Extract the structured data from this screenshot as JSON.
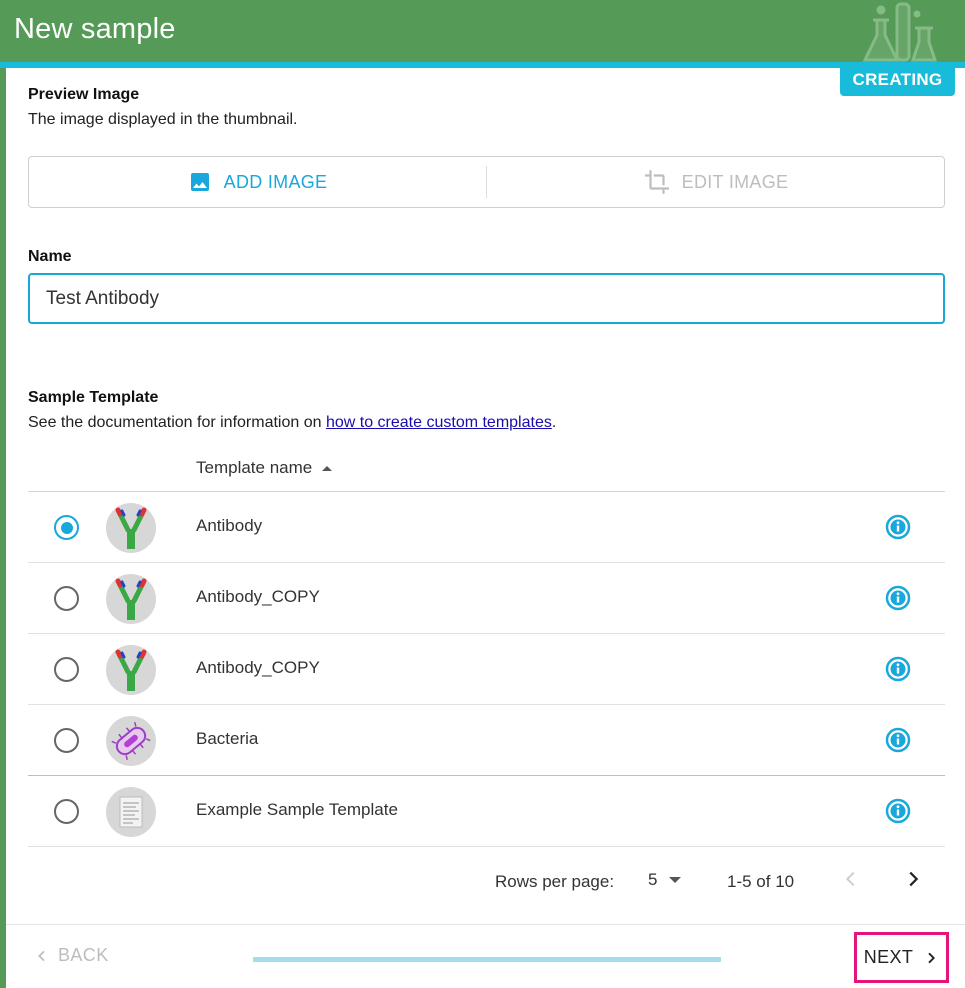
{
  "header": {
    "title": "New sample",
    "status_badge": "CREATING"
  },
  "preview_image": {
    "title": "Preview Image",
    "description": "The image displayed in the thumbnail.",
    "add_label": "ADD IMAGE",
    "edit_label": "EDIT IMAGE"
  },
  "name_field": {
    "label": "Name",
    "value": "Test Antibody"
  },
  "template": {
    "title": "Sample Template",
    "description_prefix": "See the documentation for information on ",
    "link_text": "how to create custom templates",
    "description_suffix": ".",
    "column_header": "Template name",
    "sort": "ascending",
    "rows": [
      {
        "name": "Antibody",
        "selected": true,
        "icon": "antibody-icon"
      },
      {
        "name": "Antibody_COPY",
        "selected": false,
        "icon": "antibody-icon"
      },
      {
        "name": "Antibody_COPY",
        "selected": false,
        "icon": "antibody-icon"
      },
      {
        "name": "Bacteria",
        "selected": false,
        "icon": "bacteria-icon"
      },
      {
        "name": "Example Sample Template",
        "selected": false,
        "icon": "document-icon"
      }
    ]
  },
  "pagination": {
    "rows_per_page_label": "Rows per page:",
    "rows_per_page_value": "5",
    "range_text": "1-5 of 10"
  },
  "footer": {
    "back_label": "BACK",
    "next_label": "NEXT",
    "progress_fraction": 0.0
  },
  "colors": {
    "header_green": "#559a57",
    "accent_cyan": "#18bbd9",
    "link_blue": "#1aa7dc",
    "highlight_pink": "#e5147d"
  }
}
